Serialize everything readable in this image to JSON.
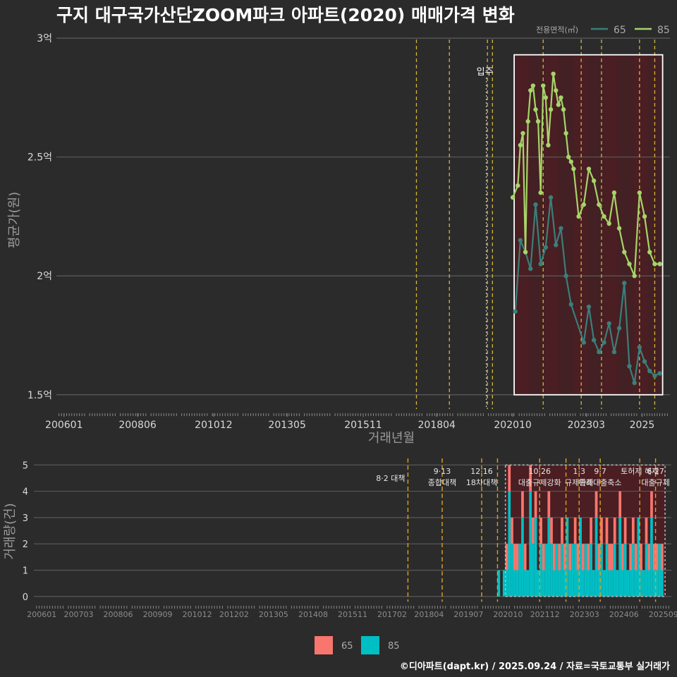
{
  "title": "구지 대구국가산단ZOOM파크 아파트(2020) 매매가격 변화",
  "footer": "©디아파트(dapt.kr) / 2025.09.24 / 자료=국토교통부 실거래가",
  "colors": {
    "bg": "#2b2b2b",
    "grid": "#5c5c5c",
    "text": "#d9d9d9",
    "s65": "#3a7f7b",
    "s85": "#a6d46a",
    "bar65": "#f8766d",
    "bar85": "#00bfc4",
    "vline": "#d4b53a",
    "box": "#ffffff",
    "shade": "#4a1e22"
  },
  "chart_data": [
    {
      "type": "line",
      "title": "구지 대구국가산단ZOOM파크 아파트(2020) 매매가격 변화",
      "xlabel": "거래년월",
      "ylabel": "평균가(원)",
      "ylim": [
        1.44,
        3.03
      ],
      "xlim": [
        "2005-10",
        "2025-12"
      ],
      "x_ticks": [
        "200601",
        "200806",
        "201012",
        "201305",
        "201511",
        "201804",
        "202010",
        "202303",
        "2025"
      ],
      "y_ticks": [
        {
          "value": 1.5,
          "label": "1.5억"
        },
        {
          "value": 2.0,
          "label": "2억"
        },
        {
          "value": 2.5,
          "label": "2.5억"
        },
        {
          "value": 3.0,
          "label": "3억"
        }
      ],
      "legend": {
        "title": "전용면적(㎡)",
        "position": "top-right"
      },
      "annotation": {
        "text": "입주",
        "x": "2019-11"
      },
      "vlines": [
        "2017-08",
        "2018-09",
        "2019-12",
        "2020-02",
        "2021-10",
        "2023-01",
        "2023-09",
        "2024-12",
        "2025-06"
      ],
      "series": [
        {
          "name": "65",
          "x": [
            "2020-11",
            "2021-01",
            "2021-03",
            "2021-05",
            "2021-07",
            "2021-09",
            "2021-11",
            "2022-01",
            "2022-03",
            "2022-05",
            "2022-07",
            "2022-09",
            "2023-02",
            "2023-04",
            "2023-06",
            "2023-08",
            "2023-10",
            "2023-12",
            "2024-02",
            "2024-04",
            "2024-06",
            "2024-08",
            "2024-10",
            "2024-12",
            "2025-02",
            "2025-04",
            "2025-06",
            "2025-08"
          ],
          "y": [
            1.85,
            2.15,
            2.1,
            2.03,
            2.3,
            2.05,
            2.12,
            2.33,
            2.13,
            2.2,
            2.0,
            1.88,
            1.72,
            1.87,
            1.73,
            1.68,
            1.72,
            1.8,
            1.68,
            1.78,
            1.97,
            1.62,
            1.55,
            1.7,
            1.64,
            1.6,
            1.58,
            1.59
          ]
        },
        {
          "name": "85",
          "x": [
            "2020-10",
            "2020-12",
            "2021-01",
            "2021-02",
            "2021-03",
            "2021-04",
            "2021-05",
            "2021-06",
            "2021-07",
            "2021-08",
            "2021-09",
            "2021-10",
            "2021-11",
            "2021-12",
            "2022-01",
            "2022-02",
            "2022-03",
            "2022-04",
            "2022-05",
            "2022-06",
            "2022-07",
            "2022-08",
            "2022-09",
            "2022-10",
            "2022-12",
            "2023-02",
            "2023-04",
            "2023-06",
            "2023-08",
            "2023-10",
            "2023-12",
            "2024-02",
            "2024-04",
            "2024-06",
            "2024-08",
            "2024-10",
            "2024-12",
            "2025-02",
            "2025-04",
            "2025-06",
            "2025-08"
          ],
          "y": [
            2.33,
            2.38,
            2.55,
            2.6,
            2.1,
            2.65,
            2.78,
            2.8,
            2.7,
            2.65,
            2.35,
            2.8,
            2.75,
            2.55,
            2.7,
            2.85,
            2.78,
            2.72,
            2.75,
            2.7,
            2.6,
            2.5,
            2.48,
            2.45,
            2.25,
            2.3,
            2.45,
            2.4,
            2.3,
            2.25,
            2.22,
            2.35,
            2.2,
            2.1,
            2.05,
            2.0,
            2.35,
            2.25,
            2.1,
            2.05,
            2.05
          ]
        }
      ]
    },
    {
      "type": "bar",
      "xlabel": "",
      "ylabel": "거래량(건)",
      "ylim": [
        -0.3,
        5.25
      ],
      "xlim": [
        "2005-10",
        "2025-12"
      ],
      "x_ticks": [
        "200601",
        "200703",
        "200806",
        "200909",
        "201012",
        "201202",
        "201305",
        "201408",
        "201511",
        "201702",
        "201804",
        "201907",
        "202010",
        "202112",
        "202303",
        "202406",
        "202509"
      ],
      "y_ticks": [
        0,
        1,
        2,
        3,
        4,
        5
      ],
      "legend": {
        "position": "bottom"
      },
      "stacked": true,
      "policy_lines": [
        {
          "x": "2017-08",
          "labels": [
            "8·2 대책"
          ],
          "mode": "left"
        },
        {
          "x": "2018-09",
          "labels": [
            "9·13",
            "종합대책"
          ],
          "mode": "center"
        },
        {
          "x": "2019-12",
          "labels": [
            "12·16",
            "18차대책"
          ],
          "mode": "center"
        },
        {
          "x": "2020-06",
          "labels": [],
          "mode": "center"
        },
        {
          "x": "2021-10",
          "labels": [
            "10·26",
            "대출규제강화"
          ],
          "mode": "center"
        },
        {
          "x": "2022-08",
          "labels": [],
          "mode": "center"
        },
        {
          "x": "2023-01",
          "labels": [
            "1·3",
            "규제완화"
          ],
          "mode": "center"
        },
        {
          "x": "2023-09",
          "labels": [
            "9·7",
            "특례대출축소"
          ],
          "mode": "center"
        },
        {
          "x": "2024-12",
          "labels": [
            "토허제 해제"
          ],
          "mode": "center"
        },
        {
          "x": "2025-06",
          "labels": [
            "6·27",
            "대출규제"
          ],
          "mode": "center"
        }
      ],
      "months": [
        "2020-06",
        "2020-08",
        "2020-09",
        "2020-10",
        "2020-11",
        "2020-12",
        "2021-01",
        "2021-02",
        "2021-03",
        "2021-04",
        "2021-05",
        "2021-06",
        "2021-07",
        "2021-08",
        "2021-09",
        "2021-10",
        "2021-11",
        "2021-12",
        "2022-01",
        "2022-02",
        "2022-03",
        "2022-04",
        "2022-05",
        "2022-06",
        "2022-07",
        "2022-08",
        "2022-09",
        "2022-10",
        "2022-11",
        "2022-12",
        "2023-01",
        "2023-02",
        "2023-03",
        "2023-04",
        "2023-05",
        "2023-06",
        "2023-07",
        "2023-08",
        "2023-09",
        "2023-10",
        "2023-11",
        "2023-12",
        "2024-01",
        "2024-02",
        "2024-03",
        "2024-04",
        "2024-05",
        "2024-06",
        "2024-07",
        "2024-08",
        "2024-09",
        "2024-10",
        "2024-11",
        "2024-12",
        "2025-01",
        "2025-02",
        "2025-03",
        "2025-04",
        "2025-05",
        "2025-06",
        "2025-07",
        "2025-08"
      ],
      "series": [
        {
          "name": "65",
          "values": [
            0,
            0,
            1,
            1,
            1,
            1,
            1,
            0,
            1,
            1,
            0,
            1,
            1,
            1,
            0,
            1,
            1,
            0,
            1,
            1,
            1,
            0,
            1,
            1,
            1,
            0,
            1,
            0,
            1,
            1,
            0,
            1,
            0,
            1,
            1,
            0,
            1,
            1,
            1,
            0,
            1,
            1,
            1,
            1,
            0,
            1,
            1,
            1,
            0,
            1,
            1,
            1,
            0,
            1,
            0,
            1,
            1,
            1,
            1,
            1,
            0,
            1
          ]
        },
        {
          "name": "85",
          "values": [
            1,
            1,
            1,
            4,
            2,
            1,
            1,
            2,
            3,
            1,
            1,
            4,
            2,
            3,
            1,
            2,
            1,
            2,
            3,
            2,
            1,
            2,
            1,
            2,
            1,
            3,
            1,
            2,
            2,
            1,
            3,
            1,
            2,
            1,
            2,
            1,
            3,
            1,
            2,
            1,
            2,
            1,
            1,
            2,
            1,
            3,
            1,
            2,
            1,
            1,
            2,
            1,
            3,
            1,
            1,
            2,
            1,
            3,
            1,
            1,
            2,
            1
          ]
        }
      ]
    }
  ]
}
